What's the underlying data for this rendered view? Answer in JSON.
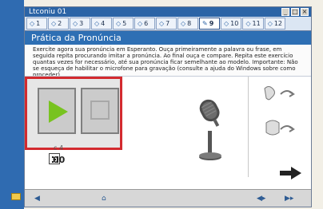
{
  "window": {
    "title": "Ltconiu 01",
    "controls": [
      "_",
      "□",
      "×"
    ]
  },
  "tabs": [
    {
      "icon": "exercise-icon",
      "label": "1"
    },
    {
      "icon": "exercise-icon",
      "label": "2"
    },
    {
      "icon": "exercise-icon",
      "label": "3"
    },
    {
      "icon": "exercise-icon",
      "label": "4"
    },
    {
      "icon": "exercise-icon",
      "label": "5"
    },
    {
      "icon": "exercise-icon",
      "label": "6"
    },
    {
      "icon": "exercise-icon",
      "label": "7"
    },
    {
      "icon": "exercise-icon",
      "label": "8"
    },
    {
      "icon": "pronunciation-icon",
      "label": "9"
    },
    {
      "icon": "exercise-icon",
      "label": "10"
    },
    {
      "icon": "exercise-icon",
      "label": "11"
    },
    {
      "icon": "exercise-icon",
      "label": "12"
    }
  ],
  "section": {
    "title": "Prática da Pronúncia"
  },
  "instruction": {
    "text": "Exercite agora sua pronúncia em Esperanto. Ouça primeiramente a palavra ou frase, em seguida repita procurando imitar a pronúncia. Ao final ouça e compare. Repita este exercício quantas vezes for necessário, até sua pronúncia ficar semelhante ao modelo. Importante: Não se esqueça de habilitar o microfone para gravação (consulte a ajuda do Windows sobre como proceder)."
  },
  "player": {
    "play_label": "play",
    "stop_label": "stop"
  },
  "stats": {
    "small_counter": "c 4",
    "score": "00"
  },
  "colors": {
    "highlight": "#d32a2f",
    "play_green": "#78c320",
    "title_blue": "#2e6fb4"
  }
}
